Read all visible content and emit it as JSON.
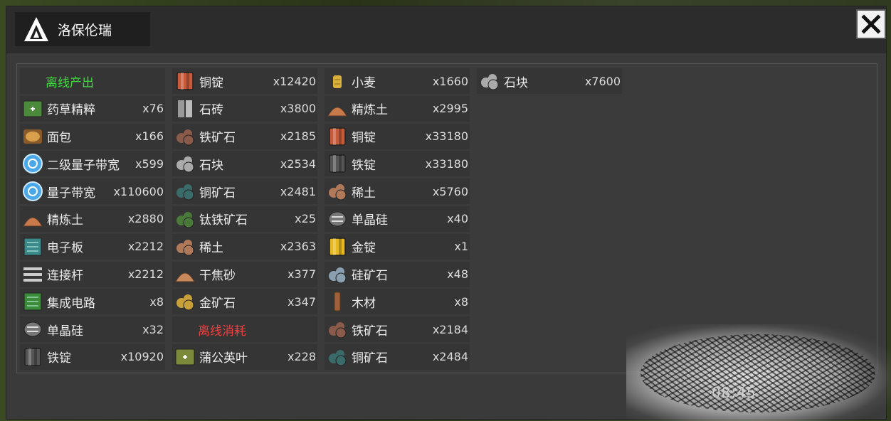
{
  "window": {
    "title": "洛保伦瑞",
    "close_label": "✕"
  },
  "columns": [
    [
      {
        "type": "header",
        "kind": "out",
        "label": "离线产出"
      },
      {
        "name": "药草精粹",
        "qty": "x76",
        "icon": "herb-essence-icon",
        "color": "#4a8a3a"
      },
      {
        "name": "面包",
        "qty": "x166",
        "icon": "bread-icon",
        "color": "#d8a04a"
      },
      {
        "name": "二级量子带宽",
        "qty": "x599",
        "icon": "quantum-bandwidth-2-icon",
        "color": "#4aa8e8"
      },
      {
        "name": "量子带宽",
        "qty": "x110600",
        "icon": "quantum-bandwidth-icon",
        "color": "#4aa8e8"
      },
      {
        "name": "精炼土",
        "qty": "x2880",
        "icon": "refined-soil-icon",
        "color": "#c87a4a"
      },
      {
        "name": "电子板",
        "qty": "x2212",
        "icon": "circuit-board-icon",
        "color": "#3a8a8a"
      },
      {
        "name": "连接杆",
        "qty": "x2212",
        "icon": "connecting-rod-icon",
        "color": "#888888"
      },
      {
        "name": "集成电路",
        "qty": "x8",
        "icon": "integrated-circuit-icon",
        "color": "#3a8a3a"
      },
      {
        "name": "单晶硅",
        "qty": "x32",
        "icon": "monocrystal-silicon-icon",
        "color": "#777777"
      },
      {
        "name": "铁锭",
        "qty": "x10920",
        "icon": "iron-ingot-icon",
        "color": "#555555"
      }
    ],
    [
      {
        "name": "铜锭",
        "qty": "x12420",
        "icon": "copper-ingot-icon",
        "color": "#c85a3a"
      },
      {
        "name": "石砖",
        "qty": "x3800",
        "icon": "stone-brick-icon",
        "color": "#999999"
      },
      {
        "name": "铁矿石",
        "qty": "x2185",
        "icon": "iron-ore-icon",
        "color": "#8a5a4a"
      },
      {
        "name": "石块",
        "qty": "x2534",
        "icon": "stone-block-icon",
        "color": "#aaaaaa"
      },
      {
        "name": "铜矿石",
        "qty": "x2481",
        "icon": "copper-ore-icon",
        "color": "#3a6a6a"
      },
      {
        "name": "钛铁矿石",
        "qty": "x25",
        "icon": "titanium-iron-ore-icon",
        "color": "#4a7a3a"
      },
      {
        "name": "稀土",
        "qty": "x2363",
        "icon": "rare-earth-icon",
        "color": "#b07a5a"
      },
      {
        "name": "干焦砂",
        "qty": "x377",
        "icon": "dry-coke-sand-icon",
        "color": "#c88a5a"
      },
      {
        "name": "金矿石",
        "qty": "x347",
        "icon": "gold-ore-icon",
        "color": "#c8a03a"
      },
      {
        "type": "header",
        "kind": "in",
        "label": "离线消耗"
      },
      {
        "name": "蒲公英叶",
        "qty": "x228",
        "icon": "dandelion-leaf-icon",
        "color": "#7a8a3a"
      }
    ],
    [
      {
        "name": "小麦",
        "qty": "x1660",
        "icon": "wheat-icon",
        "color": "#d8b03a"
      },
      {
        "name": "精炼土",
        "qty": "x2995",
        "icon": "refined-soil-icon",
        "color": "#c87a4a"
      },
      {
        "name": "铜锭",
        "qty": "x33180",
        "icon": "copper-ingot-icon",
        "color": "#c85a3a"
      },
      {
        "name": "铁锭",
        "qty": "x33180",
        "icon": "iron-ingot-icon",
        "color": "#555555"
      },
      {
        "name": "稀土",
        "qty": "x5760",
        "icon": "rare-earth-icon",
        "color": "#b07a5a"
      },
      {
        "name": "单晶硅",
        "qty": "x40",
        "icon": "monocrystal-silicon-icon",
        "color": "#777777"
      },
      {
        "name": "金锭",
        "qty": "x1",
        "icon": "gold-ingot-icon",
        "color": "#e8b820"
      },
      {
        "name": "硅矿石",
        "qty": "x48",
        "icon": "silicon-ore-icon",
        "color": "#8aa0b0"
      },
      {
        "name": "木材",
        "qty": "x8",
        "icon": "wood-icon",
        "color": "#a0603a"
      },
      {
        "name": "铁矿石",
        "qty": "x2184",
        "icon": "iron-ore-icon",
        "color": "#8a5a4a"
      },
      {
        "name": "铜矿石",
        "qty": "x2484",
        "icon": "copper-ore-icon",
        "color": "#3a6a6a"
      }
    ],
    [
      {
        "name": "石块",
        "qty": "x7600",
        "icon": "stone-block-icon",
        "color": "#aaaaaa"
      }
    ]
  ],
  "watermark": {
    "time": "08:45"
  }
}
